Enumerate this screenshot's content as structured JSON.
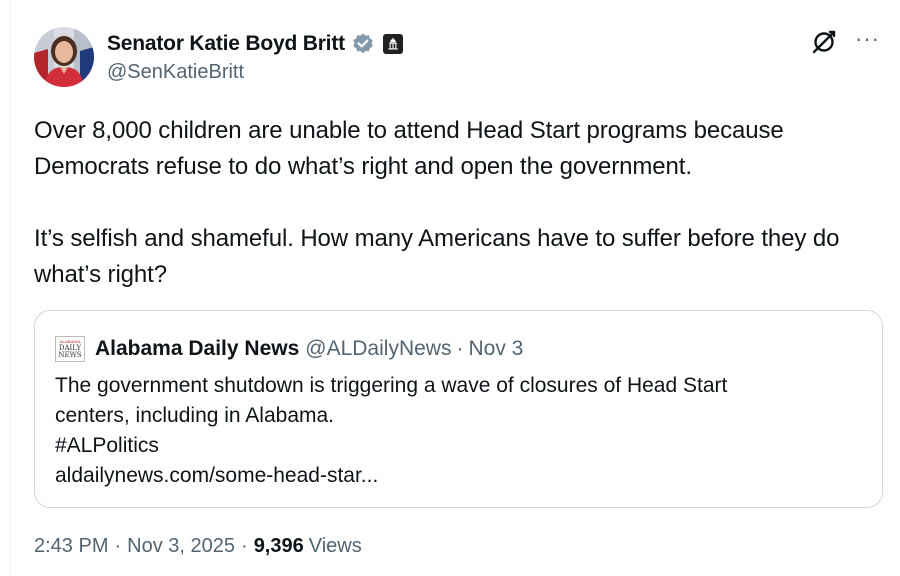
{
  "author": {
    "display_name": "Senator Katie Boyd Britt",
    "handle": "@SenKatieBritt",
    "avatar_icon": "avatar",
    "verified_icon": "verified-badge-icon",
    "gov_badge_icon": "capitol-building-icon"
  },
  "header_actions": {
    "grok_icon": "grok-icon",
    "more_label": "···"
  },
  "tweet": {
    "paragraph_1": "Over 8,000 children are unable to attend Head Start programs because Democrats refuse to do what’s right and open the government.",
    "paragraph_2": "It’s selfish and shameful. How many Americans have to suffer before they do what’s right?"
  },
  "quote": {
    "logo_lines": [
      "ALABAMA",
      "DAILY",
      "NEWS"
    ],
    "name": "Alabama Daily News",
    "handle": "@ALDailyNews",
    "separator": "·",
    "date": "Nov 3",
    "lines": [
      "The government shutdown is triggering a wave of closures of Head Start",
      "centers, including in Alabama.",
      "#ALPolitics",
      "aldailynews.com/some-head-star..."
    ]
  },
  "meta": {
    "time": "2:43 PM",
    "separator": "·",
    "date": "Nov 3, 2025",
    "views_count": "9,396",
    "views_label": "Views"
  },
  "colors": {
    "text": "#0f1419",
    "secondary": "#536471",
    "border": "#cfd9de",
    "verified": "#829aab"
  }
}
